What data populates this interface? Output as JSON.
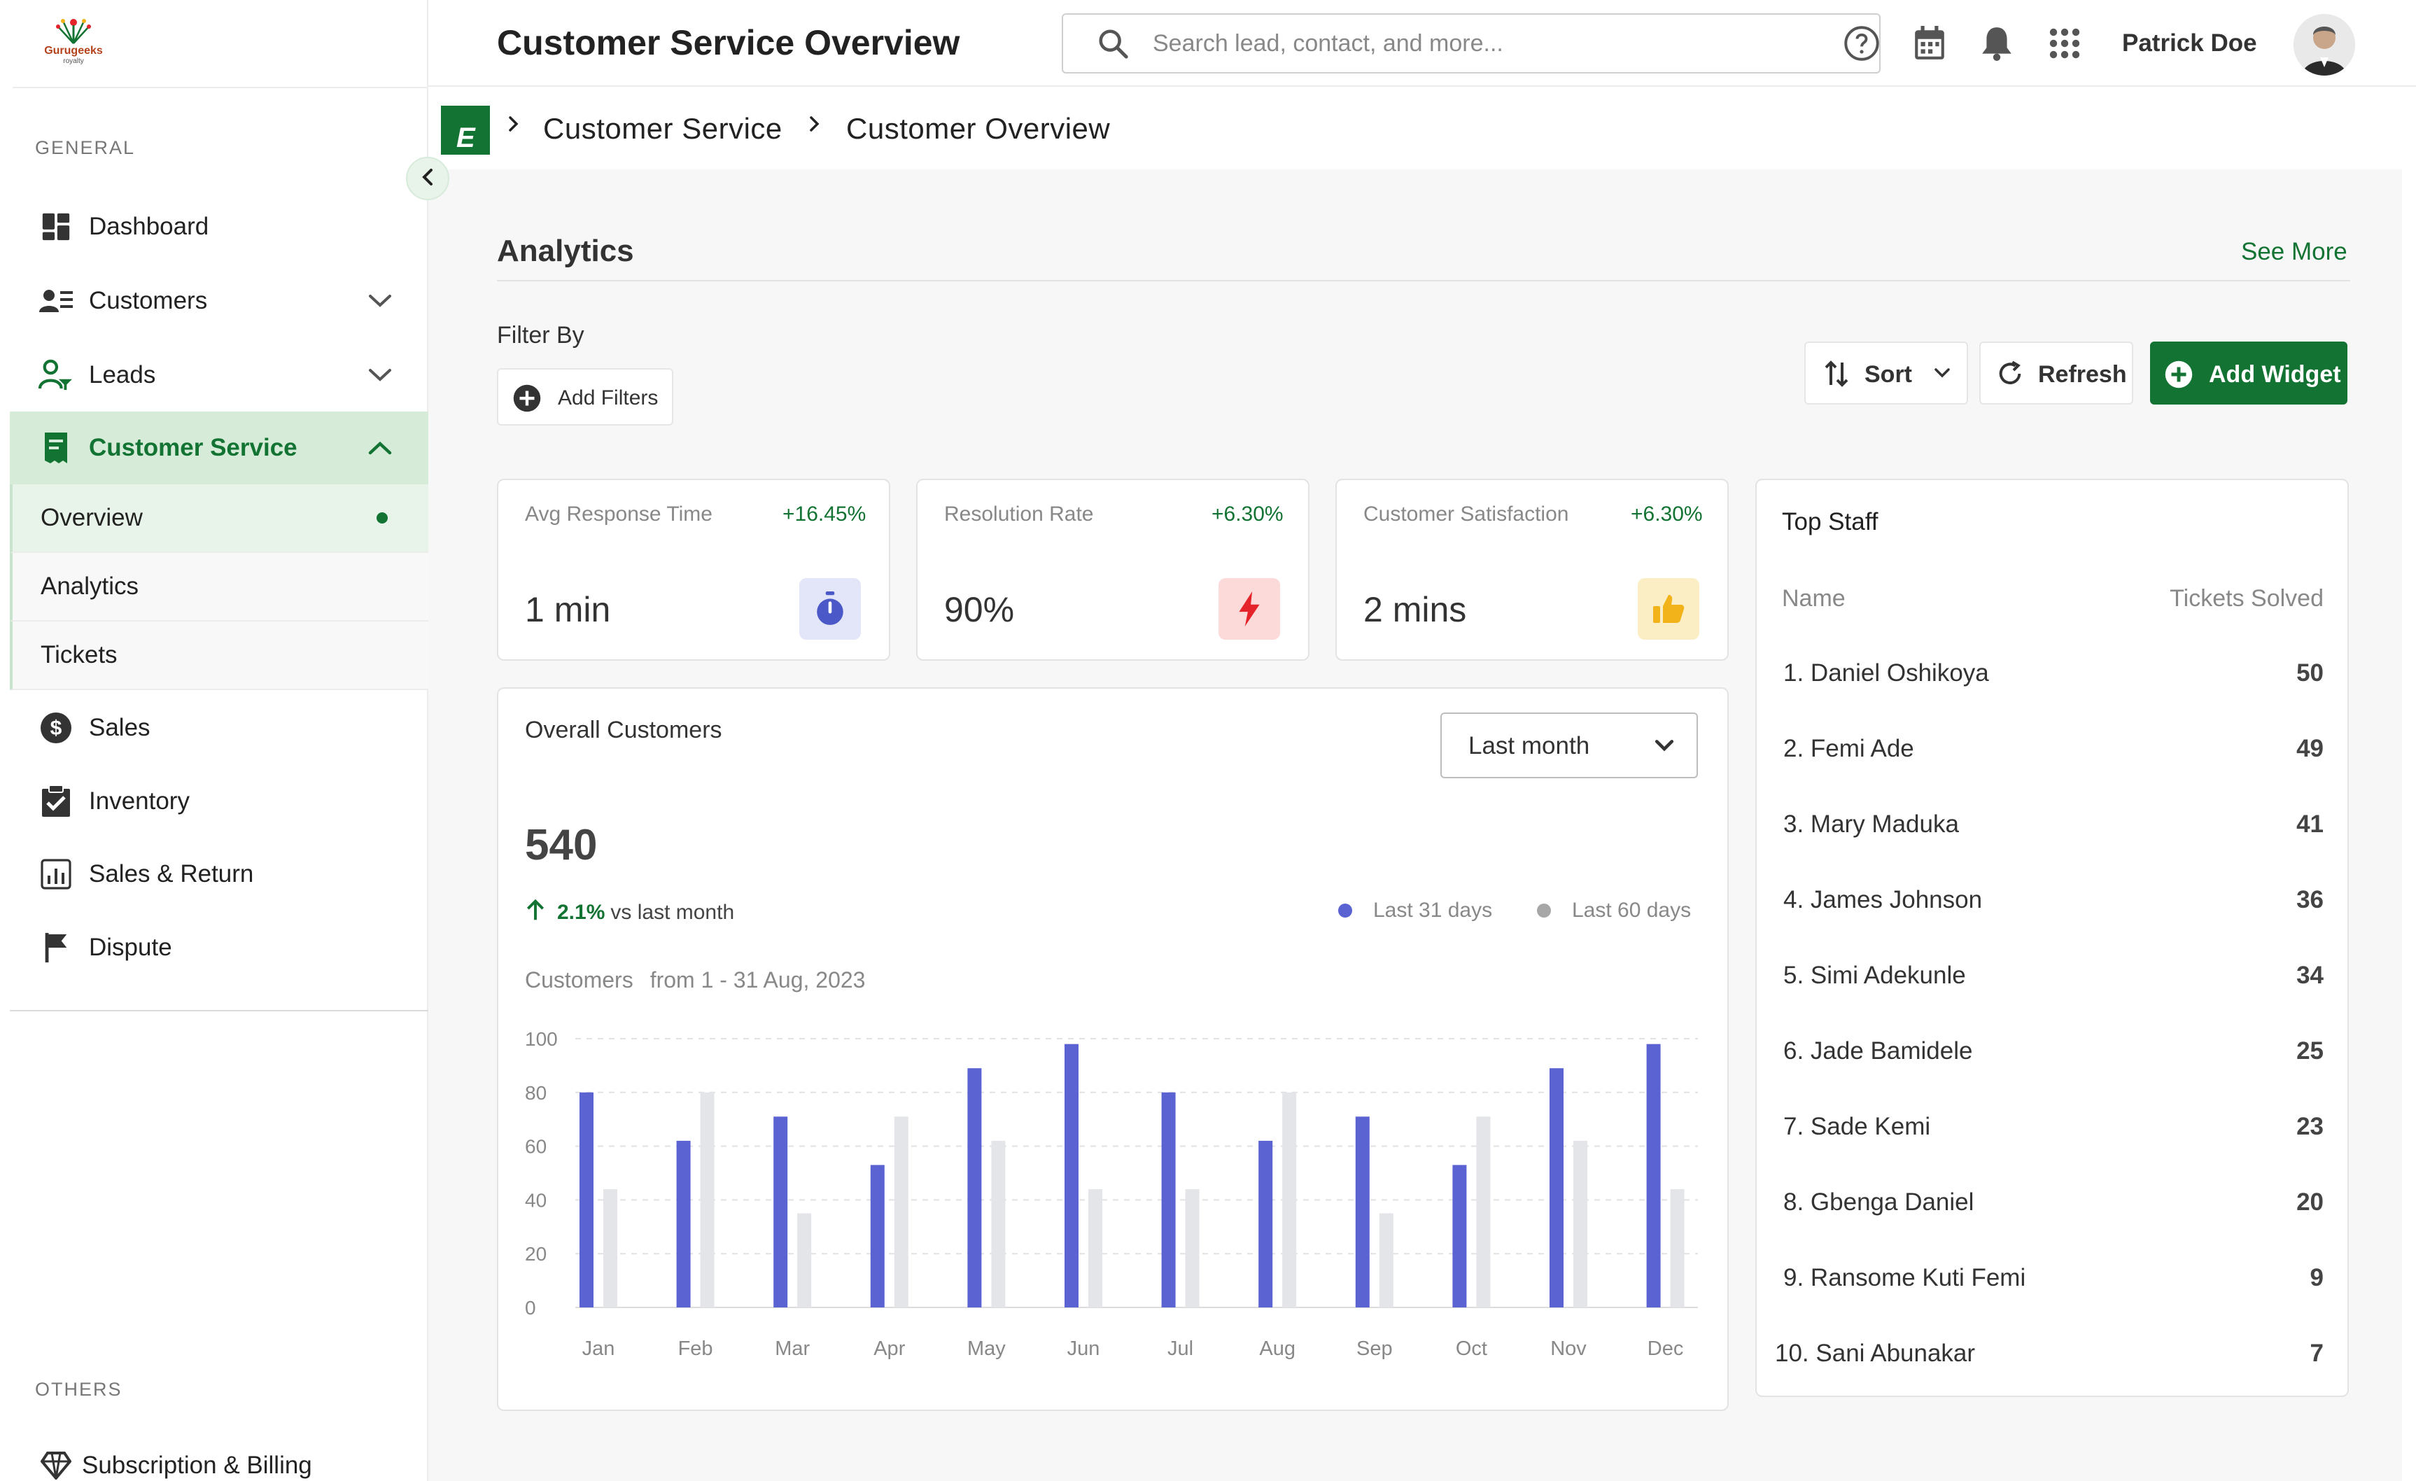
{
  "brand": {
    "name": "Gurugeeks",
    "tagline": "royalty"
  },
  "sidebar": {
    "general_label": "GENERAL",
    "others_label": "OTHERS",
    "items": [
      {
        "label": "Dashboard",
        "icon": "dashboard-icon"
      },
      {
        "label": "Customers",
        "icon": "customers-icon",
        "expandable": true
      },
      {
        "label": "Leads",
        "icon": "leads-icon",
        "expandable": true
      },
      {
        "label": "Customer Service",
        "icon": "receipt-icon",
        "expanded": true,
        "active": true
      },
      {
        "label": "Sales",
        "icon": "dollar-icon"
      },
      {
        "label": "Inventory",
        "icon": "clipboard-check-icon"
      },
      {
        "label": "Sales & Return",
        "icon": "bar-chart-icon"
      },
      {
        "label": "Dispute",
        "icon": "flag-icon"
      }
    ],
    "sub_items": [
      {
        "label": "Overview",
        "active": true
      },
      {
        "label": "Analytics"
      },
      {
        "label": "Tickets"
      }
    ],
    "others": [
      {
        "label": "Subscription & Billing",
        "icon": "gem-icon"
      }
    ]
  },
  "header": {
    "title": "Customer Service Overview",
    "search_placeholder": "Search lead, contact, and more...",
    "user_name": "Patrick Doe"
  },
  "breadcrumb": {
    "logo_letter": "E",
    "items": [
      "Customer Service",
      "Customer Overview"
    ]
  },
  "analytics": {
    "title": "Analytics",
    "see_more": "See More",
    "filter_label": "Filter By",
    "add_filters": "Add Filters",
    "sort": "Sort",
    "refresh": "Refresh",
    "add_widget": "Add Widget"
  },
  "stats": [
    {
      "name": "Avg Response Time",
      "delta": "+16.45%",
      "value": "1 min",
      "icon": "stopwatch-icon",
      "badge_bg": "#e3e5f8",
      "icon_color": "#4a58c8"
    },
    {
      "name": "Resolution Rate",
      "delta": "+6.30%",
      "value": "90%",
      "icon": "lightning-icon",
      "badge_bg": "#fcdada",
      "icon_color": "#e4232b"
    },
    {
      "name": "Customer Satisfaction",
      "delta": "+6.30%",
      "value": "2 mins",
      "icon": "thumbs-up-icon",
      "badge_bg": "#fbeec4",
      "icon_color": "#f2b31a"
    }
  ],
  "overall": {
    "title": "Overall Customers",
    "period": "Last month",
    "total": "540",
    "trend_pct": "2.1%",
    "trend_text": "vs last month",
    "legend": [
      {
        "label": "Last 31 days",
        "color": "#5b63d3"
      },
      {
        "label": "Last 60 days",
        "color": "#a7a7a7"
      }
    ],
    "range_label": "Customers",
    "range_text": "from 1 - 31 Aug, 2023"
  },
  "chart_data": {
    "type": "bar",
    "categories": [
      "Jan",
      "Feb",
      "Mar",
      "Apr",
      "May",
      "Jun",
      "Jul",
      "Aug",
      "Sep",
      "Oct",
      "Nov",
      "Dec"
    ],
    "series": [
      {
        "name": "Last 31 days",
        "values": [
          80,
          62,
          71,
          53,
          89,
          98,
          80,
          62,
          71,
          53,
          89,
          98
        ],
        "color": "#5b63d3"
      },
      {
        "name": "Last 60 days",
        "values": [
          44,
          80,
          35,
          71,
          62,
          44,
          44,
          80,
          35,
          71,
          62,
          44
        ],
        "color": "#e4e5e8"
      }
    ],
    "yticks": [
      0,
      20,
      40,
      60,
      80,
      100
    ],
    "ylim": [
      0,
      100
    ],
    "grid": true
  },
  "top_staff": {
    "title": "Top Staff",
    "col_name": "Name",
    "col_value": "Tickets Solved",
    "rows": [
      {
        "name": "1. Daniel Oshikoya",
        "value": "50"
      },
      {
        "name": "2. Femi Ade",
        "value": "49"
      },
      {
        "name": "3. Mary Maduka",
        "value": "41"
      },
      {
        "name": "4. James Johnson",
        "value": "36"
      },
      {
        "name": "5. Simi Adekunle",
        "value": "34"
      },
      {
        "name": "6. Jade Bamidele",
        "value": "25"
      },
      {
        "name": "7. Sade Kemi",
        "value": "23"
      },
      {
        "name": "8. Gbenga Daniel",
        "value": "20"
      },
      {
        "name": "9. Ransome Kuti Femi",
        "value": "9"
      },
      {
        "name": "10. Sani Abunakar",
        "value": "7"
      }
    ]
  }
}
